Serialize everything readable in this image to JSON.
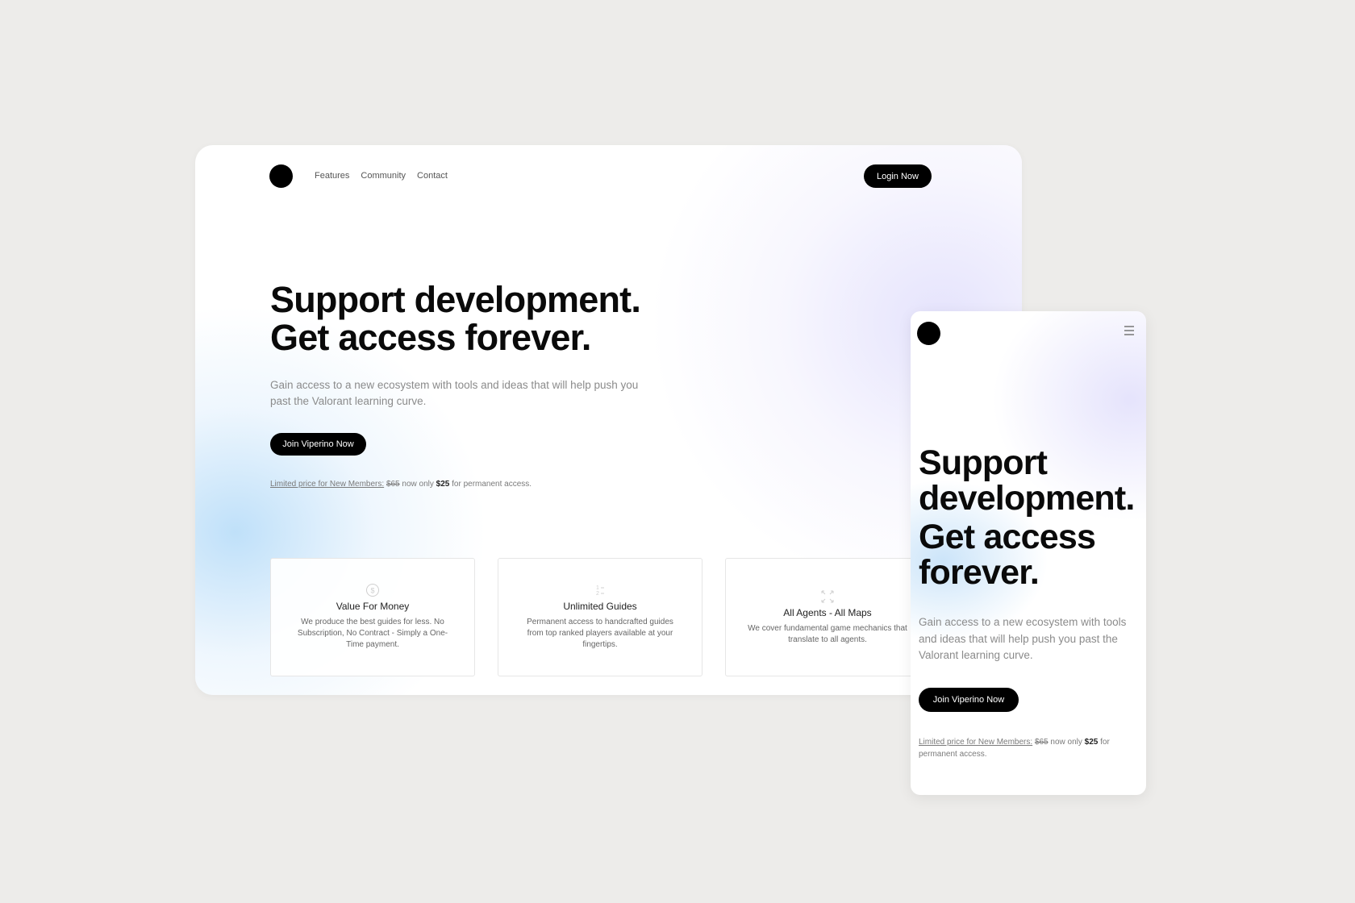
{
  "desktop": {
    "nav": {
      "links": [
        "Features",
        "Community",
        "Contact"
      ],
      "login_label": "Login Now"
    },
    "hero": {
      "title_line1": "Support development.",
      "title_line2": "Get access forever.",
      "subtitle": "Gain access to a new ecosystem with tools and ideas that will help push you past the Valorant learning curve.",
      "cta_label": "Join Viperino Now"
    },
    "promo": {
      "limited": "Limited price for New Members:",
      "old_price": "$65",
      "middle": "now only",
      "new_price": "$25",
      "suffix": "for permanent access."
    },
    "features": [
      {
        "icon": "dollar-coin-icon",
        "title": "Value For Money",
        "text": "We produce the best guides for less. No Subscription, No Contract - Simply a One-Time payment."
      },
      {
        "icon": "guides-icon",
        "title": "Unlimited Guides",
        "text": "Permanent access to handcrafted guides from top ranked players available at your fingertips."
      },
      {
        "icon": "expand-arrows-icon",
        "title": "All Agents - All Maps",
        "text": "We cover fundamental game mechanics that translate to all agents."
      }
    ]
  },
  "mobile": {
    "menu_icon": "hamburger-menu-icon",
    "hero": {
      "title_line1": "Support",
      "title_line2": "development.",
      "title_line3": "Get access",
      "title_line4": "forever.",
      "subtitle": "Gain access to a new ecosystem with tools and ideas that will help push you past the Valorant learning curve.",
      "cta_label": "Join Viperino Now"
    },
    "promo": {
      "limited": "Limited price for New Members:",
      "old_price": "$65",
      "middle": "now only",
      "new_price": "$25",
      "suffix": "for permanent access."
    }
  },
  "colors": {
    "page_background": "#edecea",
    "button": "#000000",
    "button_text": "#ffffff",
    "glow_blue": "#cfe6fb",
    "glow_purple": "#e6e4fc"
  }
}
